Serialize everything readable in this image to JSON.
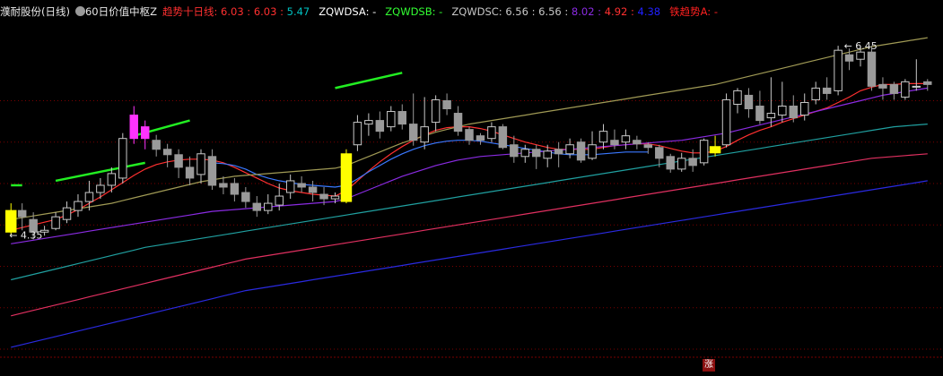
{
  "header": {
    "stock_name": "濮耐股份(日线)",
    "indicator_name": "60日价值中枢Z",
    "items": [
      {
        "label": "趋势十日线:",
        "values": [
          "6.03",
          "6.03",
          "5.47"
        ],
        "label_color": "#ff3030",
        "value_colors": [
          "#ff3030",
          "#ff3030",
          "#00c0c0"
        ]
      },
      {
        "label": "ZQWDSA:",
        "values": [
          "-"
        ],
        "label_color": "#ffffff",
        "value_colors": [
          "#ffffff"
        ]
      },
      {
        "label": "ZQWDSB:",
        "values": [
          "-"
        ],
        "label_color": "#33ff33",
        "value_colors": [
          "#33ff33"
        ]
      },
      {
        "label": "ZQWDSC:",
        "values": [
          "6.56",
          "6.56",
          "8.02",
          "4.92",
          "4.38"
        ],
        "label_color": "#c8c8c8",
        "value_colors": [
          "#c8c8c8",
          "#c8c8c8",
          "#8a2be2",
          "#ff3030",
          "#2020ff"
        ]
      },
      {
        "label": "铁趋势A:",
        "values": [
          "-"
        ],
        "label_color": "#ff2020",
        "value_colors": [
          "#ff2020"
        ]
      }
    ]
  },
  "footer": {
    "badge": "涨"
  },
  "chart_data": {
    "type": "candlestick",
    "price_labels": {
      "high": "6.45",
      "low": "4.35"
    },
    "ylim": [
      3.0,
      6.7
    ],
    "candles": [
      [
        4.38,
        4.62,
        4.35,
        4.7
      ],
      [
        4.62,
        4.55,
        4.4,
        4.7
      ],
      [
        4.52,
        4.38,
        4.3,
        4.6
      ],
      [
        4.38,
        4.4,
        4.34,
        4.45
      ],
      [
        4.42,
        4.55,
        4.4,
        4.6
      ],
      [
        4.52,
        4.65,
        4.48,
        4.72
      ],
      [
        4.62,
        4.72,
        4.55,
        4.8
      ],
      [
        4.72,
        4.82,
        4.62,
        4.95
      ],
      [
        4.82,
        4.9,
        4.75,
        4.98
      ],
      [
        4.9,
        5.03,
        4.82,
        5.1
      ],
      [
        4.98,
        5.42,
        4.92,
        5.48
      ],
      [
        5.42,
        5.68,
        5.36,
        5.78
      ],
      [
        5.55,
        5.42,
        5.3,
        5.62
      ],
      [
        5.4,
        5.3,
        5.22,
        5.46
      ],
      [
        5.3,
        5.24,
        5.1,
        5.36
      ],
      [
        5.24,
        5.1,
        4.98,
        5.3
      ],
      [
        5.1,
        4.98,
        4.9,
        5.22
      ],
      [
        5.02,
        5.25,
        4.92,
        5.3
      ],
      [
        5.22,
        4.9,
        4.85,
        5.3
      ],
      [
        4.92,
        4.88,
        4.8,
        5.0
      ],
      [
        4.92,
        4.8,
        4.72,
        4.98
      ],
      [
        4.82,
        4.72,
        4.65,
        4.88
      ],
      [
        4.7,
        4.62,
        4.55,
        4.78
      ],
      [
        4.62,
        4.7,
        4.58,
        4.8
      ],
      [
        4.68,
        4.78,
        4.62,
        4.92
      ],
      [
        4.82,
        4.95,
        4.75,
        5.02
      ],
      [
        4.92,
        4.88,
        4.82,
        5.0
      ],
      [
        4.88,
        4.82,
        4.72,
        4.95
      ],
      [
        4.8,
        4.75,
        4.68,
        4.88
      ],
      [
        4.75,
        4.78,
        4.7,
        4.82
      ],
      [
        4.72,
        5.25,
        4.7,
        5.3
      ],
      [
        5.35,
        5.6,
        5.28,
        5.68
      ],
      [
        5.58,
        5.62,
        5.45,
        5.7
      ],
      [
        5.62,
        5.5,
        5.42,
        5.72
      ],
      [
        5.55,
        5.72,
        5.5,
        5.78
      ],
      [
        5.72,
        5.58,
        5.52,
        5.8
      ],
      [
        5.58,
        5.4,
        5.34,
        5.92
      ],
      [
        5.38,
        5.55,
        5.3,
        5.88
      ],
      [
        5.6,
        5.85,
        5.5,
        5.9
      ],
      [
        5.84,
        5.75,
        5.68,
        5.92
      ],
      [
        5.7,
        5.5,
        5.45,
        5.78
      ],
      [
        5.52,
        5.4,
        5.35,
        5.55
      ],
      [
        5.45,
        5.4,
        5.35,
        5.48
      ],
      [
        5.42,
        5.55,
        5.38,
        5.6
      ],
      [
        5.55,
        5.32,
        5.3,
        5.58
      ],
      [
        5.35,
        5.22,
        5.15,
        5.45
      ],
      [
        5.22,
        5.3,
        5.15,
        5.35
      ],
      [
        5.3,
        5.22,
        5.08,
        5.35
      ],
      [
        5.2,
        5.28,
        5.1,
        5.35
      ],
      [
        5.3,
        5.25,
        5.1,
        5.38
      ],
      [
        5.25,
        5.35,
        5.2,
        5.42
      ],
      [
        5.38,
        5.18,
        5.15,
        5.42
      ],
      [
        5.2,
        5.35,
        5.18,
        5.5
      ],
      [
        5.38,
        5.5,
        5.3,
        5.58
      ],
      [
        5.4,
        5.35,
        5.3,
        5.52
      ],
      [
        5.38,
        5.45,
        5.3,
        5.52
      ],
      [
        5.4,
        5.36,
        5.3,
        5.45
      ],
      [
        5.35,
        5.32,
        5.25,
        5.38
      ],
      [
        5.32,
        5.2,
        5.1,
        5.35
      ],
      [
        5.22,
        5.08,
        5.04,
        5.25
      ],
      [
        5.08,
        5.2,
        5.05,
        5.26
      ],
      [
        5.2,
        5.12,
        5.05,
        5.3
      ],
      [
        5.15,
        5.4,
        5.12,
        5.42
      ],
      [
        5.33,
        5.26,
        5.22,
        5.45
      ],
      [
        5.35,
        5.85,
        5.32,
        5.92
      ],
      [
        5.8,
        5.95,
        5.7,
        5.98
      ],
      [
        5.9,
        5.75,
        5.65,
        5.98
      ],
      [
        5.78,
        5.62,
        5.58,
        5.95
      ],
      [
        5.65,
        5.7,
        5.55,
        6.1
      ],
      [
        5.68,
        5.78,
        5.6,
        6.05
      ],
      [
        5.78,
        5.65,
        5.6,
        5.9
      ],
      [
        5.68,
        5.82,
        5.62,
        5.92
      ],
      [
        5.85,
        5.98,
        5.8,
        6.05
      ],
      [
        5.98,
        5.92,
        5.85,
        6.1
      ],
      [
        5.95,
        6.4,
        5.9,
        6.45
      ],
      [
        6.35,
        6.28,
        6.18,
        6.42
      ],
      [
        6.3,
        6.38,
        6.22,
        6.45
      ],
      [
        6.38,
        6.0,
        5.95,
        6.45
      ],
      [
        6.02,
        5.98,
        5.85,
        6.1
      ],
      [
        6.02,
        5.92,
        5.85,
        6.05
      ],
      [
        5.88,
        6.05,
        5.85,
        6.08
      ],
      [
        6.0,
        6.0,
        5.95,
        6.3
      ],
      [
        6.05,
        6.02,
        5.95,
        6.08
      ]
    ],
    "highlighted": {
      "yellow": [
        0,
        30,
        63
      ],
      "magenta": [
        11,
        12
      ]
    },
    "series": [
      {
        "color": "#ff3030",
        "values": [
          4.4,
          4.43,
          4.46,
          4.49,
          4.52,
          4.57,
          4.63,
          4.7,
          4.77,
          4.85,
          4.93,
          5.01,
          5.08,
          5.13,
          5.16,
          5.18,
          5.19,
          5.19,
          5.18,
          5.15,
          5.1,
          5.04,
          4.98,
          4.92,
          4.87,
          4.84,
          4.82,
          4.8,
          4.79,
          4.78,
          4.84,
          4.95,
          5.06,
          5.16,
          5.25,
          5.33,
          5.4,
          5.46,
          5.51,
          5.54,
          5.55,
          5.55,
          5.53,
          5.5,
          5.46,
          5.42,
          5.38,
          5.35,
          5.32,
          5.3,
          5.3,
          5.3,
          5.3,
          5.32,
          5.34,
          5.35,
          5.36,
          5.36,
          5.34,
          5.31,
          5.28,
          5.26,
          5.26,
          5.28,
          5.33,
          5.4,
          5.46,
          5.51,
          5.55,
          5.6,
          5.64,
          5.68,
          5.72,
          5.76,
          5.82,
          5.88,
          5.95,
          5.99,
          6.02,
          6.02,
          6.03,
          6.03,
          6.03
        ]
      },
      {
        "color": "#3a78ff",
        "values": [
          null,
          null,
          null,
          null,
          null,
          null,
          null,
          null,
          null,
          null,
          null,
          null,
          null,
          null,
          null,
          null,
          null,
          null,
          5.15,
          5.14,
          5.12,
          5.08,
          5.02,
          4.98,
          4.95,
          4.93,
          4.91,
          4.9,
          4.89,
          4.88,
          4.9,
          4.97,
          5.05,
          5.12,
          5.19,
          5.25,
          5.3,
          5.34,
          5.37,
          5.39,
          5.4,
          5.4,
          5.39,
          5.37,
          5.35,
          5.33,
          5.31,
          5.29,
          5.27,
          5.25,
          5.24,
          5.24,
          5.24,
          5.25,
          5.26,
          5.27,
          5.27,
          5.27,
          null,
          null,
          null,
          null,
          null,
          null,
          null,
          null,
          null,
          null,
          null,
          null,
          null,
          null,
          null,
          null,
          null,
          null,
          null,
          null,
          null,
          null,
          null,
          null,
          null
        ]
      },
      {
        "color": "#8a2be2",
        "values": [
          4.25,
          4.27,
          4.29,
          4.31,
          4.33,
          4.35,
          4.37,
          4.39,
          4.41,
          4.43,
          4.45,
          4.47,
          4.49,
          4.51,
          4.53,
          4.55,
          4.57,
          4.59,
          4.61,
          4.62,
          4.63,
          4.64,
          4.65,
          4.66,
          4.67,
          4.68,
          4.69,
          4.7,
          4.71,
          4.72,
          4.75,
          4.8,
          4.85,
          4.9,
          4.95,
          5.0,
          5.04,
          5.08,
          5.12,
          5.15,
          5.18,
          5.2,
          5.22,
          5.23,
          5.24,
          5.25,
          5.26,
          5.27,
          5.28,
          5.29,
          5.3,
          5.31,
          5.32,
          5.33,
          5.34,
          5.35,
          5.36,
          5.37,
          5.38,
          5.39,
          5.4,
          5.42,
          5.44,
          5.46,
          5.48,
          5.51,
          5.54,
          5.57,
          5.6,
          5.63,
          5.66,
          5.69,
          5.72,
          5.75,
          5.78,
          5.81,
          5.84,
          5.87,
          5.9,
          5.92,
          5.94,
          5.96,
          5.98
        ]
      },
      {
        "color": "#a09a55",
        "values": [
          4.52,
          4.54,
          4.56,
          4.58,
          4.6,
          4.62,
          4.64,
          4.66,
          4.68,
          4.7,
          4.73,
          4.76,
          4.79,
          4.82,
          4.85,
          4.88,
          4.91,
          4.94,
          4.96,
          4.98,
          5.0,
          5.01,
          5.02,
          5.03,
          5.04,
          5.05,
          5.06,
          5.07,
          5.08,
          5.09,
          5.12,
          5.17,
          5.22,
          5.27,
          5.32,
          5.37,
          5.41,
          5.45,
          5.49,
          5.52,
          5.55,
          5.58,
          5.6,
          5.62,
          5.64,
          5.66,
          5.68,
          5.7,
          5.72,
          5.74,
          5.76,
          5.78,
          5.8,
          5.82,
          5.84,
          5.86,
          5.88,
          5.9,
          5.92,
          5.94,
          5.96,
          5.98,
          6.0,
          6.02,
          6.05,
          6.08,
          6.11,
          6.14,
          6.17,
          6.2,
          6.23,
          6.26,
          6.29,
          6.32,
          6.35,
          6.38,
          6.41,
          6.44,
          6.46,
          6.48,
          6.5,
          6.52,
          6.54
        ]
      },
      {
        "color": "#20a0a0",
        "values": [
          3.85,
          3.88,
          3.91,
          3.94,
          3.97,
          4.0,
          4.03,
          4.06,
          4.09,
          4.12,
          4.15,
          4.18,
          4.21,
          4.23,
          4.25,
          4.27,
          4.29,
          4.31,
          4.33,
          4.35,
          4.37,
          4.39,
          4.41,
          4.43,
          4.45,
          4.47,
          4.49,
          4.51,
          4.53,
          4.55,
          4.57,
          4.59,
          4.61,
          4.63,
          4.65,
          4.67,
          4.69,
          4.71,
          4.73,
          4.75,
          4.77,
          4.79,
          4.81,
          4.83,
          4.85,
          4.87,
          4.89,
          4.91,
          4.93,
          4.95,
          4.97,
          4.99,
          5.01,
          5.03,
          5.05,
          5.07,
          5.09,
          5.11,
          5.13,
          5.15,
          5.17,
          5.19,
          5.21,
          5.23,
          5.25,
          5.27,
          5.29,
          5.31,
          5.33,
          5.35,
          5.37,
          5.39,
          5.41,
          5.43,
          5.45,
          5.47,
          5.49,
          5.51,
          5.53,
          5.55,
          5.56,
          5.57,
          5.58
        ]
      },
      {
        "color": "#e03060",
        "values": [
          3.45,
          3.48,
          3.51,
          3.54,
          3.57,
          3.6,
          3.63,
          3.66,
          3.69,
          3.72,
          3.75,
          3.78,
          3.81,
          3.84,
          3.87,
          3.9,
          3.93,
          3.96,
          3.99,
          4.02,
          4.05,
          4.08,
          4.1,
          4.12,
          4.14,
          4.16,
          4.18,
          4.2,
          4.22,
          4.24,
          4.26,
          4.28,
          4.3,
          4.32,
          4.34,
          4.36,
          4.38,
          4.4,
          4.42,
          4.44,
          4.46,
          4.48,
          4.5,
          4.52,
          4.54,
          4.56,
          4.58,
          4.6,
          4.62,
          4.64,
          4.66,
          4.68,
          4.7,
          4.72,
          4.74,
          4.76,
          4.78,
          4.8,
          4.82,
          4.84,
          4.86,
          4.88,
          4.9,
          4.92,
          4.94,
          4.96,
          4.98,
          5.0,
          5.02,
          5.04,
          5.06,
          5.08,
          5.1,
          5.12,
          5.14,
          5.16,
          5.18,
          5.2,
          5.21,
          5.22,
          5.23,
          5.24,
          5.25
        ]
      },
      {
        "color": "#2a2ae0",
        "values": [
          3.1,
          3.13,
          3.16,
          3.19,
          3.22,
          3.25,
          3.28,
          3.31,
          3.34,
          3.37,
          3.4,
          3.43,
          3.46,
          3.49,
          3.52,
          3.55,
          3.58,
          3.61,
          3.64,
          3.67,
          3.7,
          3.73,
          3.75,
          3.77,
          3.79,
          3.81,
          3.83,
          3.85,
          3.87,
          3.89,
          3.91,
          3.93,
          3.95,
          3.97,
          3.99,
          4.01,
          4.03,
          4.05,
          4.07,
          4.09,
          4.11,
          4.13,
          4.15,
          4.17,
          4.19,
          4.21,
          4.23,
          4.25,
          4.27,
          4.29,
          4.31,
          4.33,
          4.35,
          4.37,
          4.39,
          4.41,
          4.43,
          4.45,
          4.47,
          4.49,
          4.51,
          4.53,
          4.55,
          4.57,
          4.59,
          4.61,
          4.63,
          4.65,
          4.67,
          4.69,
          4.71,
          4.73,
          4.75,
          4.77,
          4.79,
          4.81,
          4.83,
          4.85,
          4.87,
          4.89,
          4.91,
          4.93,
          4.95
        ]
      }
    ],
    "green_segments": [
      [
        0,
        1,
        4.9,
        4.9
      ],
      [
        4,
        12,
        4.95,
        5.15
      ],
      [
        11,
        16,
        5.45,
        5.62
      ],
      [
        29,
        35,
        5.98,
        6.15
      ]
    ],
    "gridlines": [
      5.84,
      5.38,
      4.92,
      4.46,
      4.0,
      3.54,
      3.08
    ]
  }
}
